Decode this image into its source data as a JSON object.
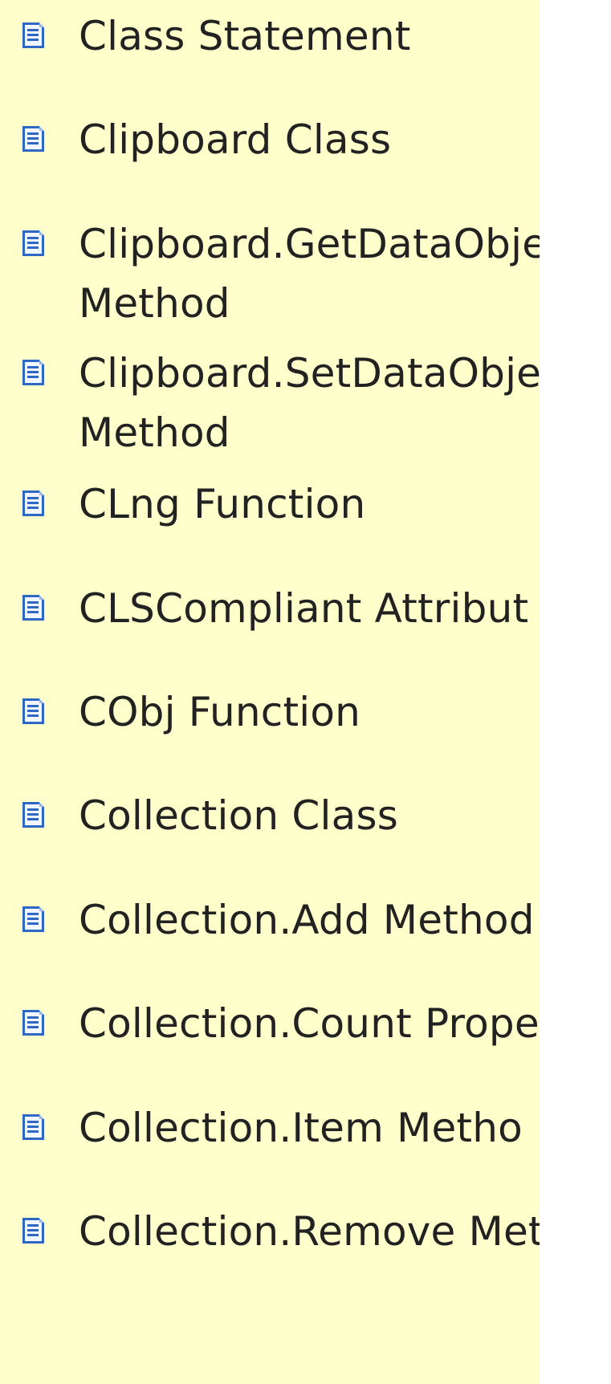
{
  "window": {
    "background_color": "#ffffcc",
    "outside_color": "#ffffff"
  },
  "items": [
    {
      "label": "Class Statement",
      "icon": "document-icon"
    },
    {
      "label": "Clipboard Class",
      "icon": "document-icon"
    },
    {
      "label": "Clipboard.GetDataObje",
      "label_line2": "Method",
      "icon": "document-icon"
    },
    {
      "label": "Clipboard.SetDataObje",
      "label_line2": "Method",
      "icon": "document-icon"
    },
    {
      "label": "CLng Function",
      "icon": "document-icon"
    },
    {
      "label": "CLSCompliant Attribut",
      "icon": "document-icon"
    },
    {
      "label": "CObj Function",
      "icon": "document-icon"
    },
    {
      "label": "Collection Class",
      "icon": "document-icon"
    },
    {
      "label": "Collection.Add Method",
      "icon": "document-icon"
    },
    {
      "label": "Collection.Count Prope",
      "icon": "document-icon"
    },
    {
      "label": "Collection.Item Metho",
      "icon": "document-icon"
    },
    {
      "label": "Collection.Remove Met",
      "icon": "document-icon"
    }
  ]
}
